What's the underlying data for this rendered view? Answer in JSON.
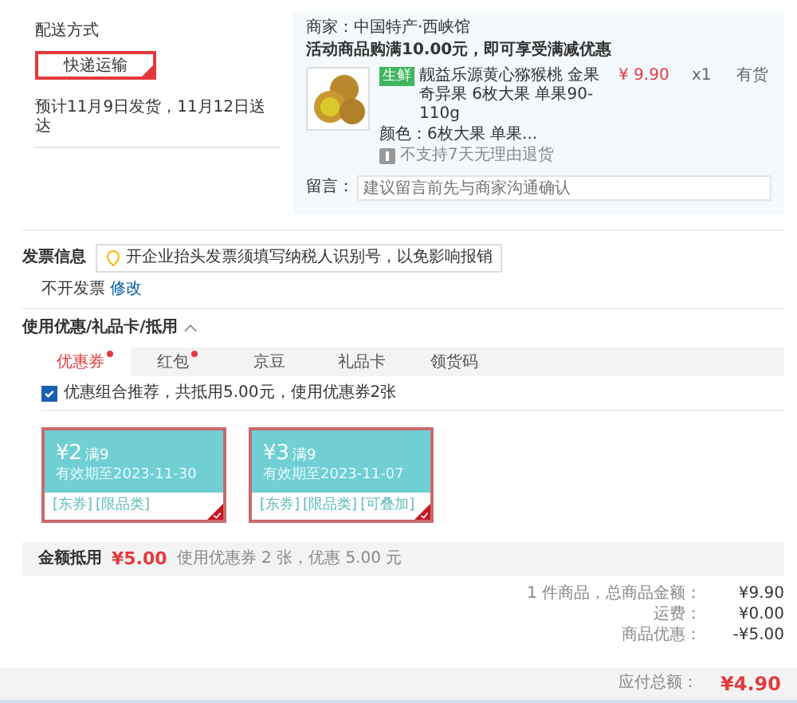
{
  "shipping": {
    "label": "配送方式",
    "method": "快递运输",
    "method_selected": true,
    "estimate": "预计11月9日发货，11月12日送达"
  },
  "shop": {
    "merchant": "商家：中国特产·西峡馆",
    "promo": "活动商品购满10.00元，即可享受满减优惠",
    "item": {
      "badge": "生鲜",
      "title": "靓益乐源黄心猕猴桃 金果奇异果 6枚大果 单果90- 110g",
      "spec": "颜色：6枚大果 单果...",
      "notice": "不支持7天无理由退货",
      "price": "¥ 9.90",
      "qty": "x1",
      "stock": "有货"
    },
    "note": {
      "label": "留言：",
      "placeholder": "建议留言前先与商家沟通确认"
    }
  },
  "invoice": {
    "title": "发票信息",
    "tip": "开企业抬头发票须填写纳税人识别号，以免影响报销",
    "value": "不开发票",
    "edit": "修改"
  },
  "discount": {
    "title": "使用优惠/礼品卡/抵用",
    "tabs": [
      {
        "label": "优惠券",
        "selected": true,
        "dot": true
      },
      {
        "label": "红包",
        "selected": false,
        "dot": true
      },
      {
        "label": "京豆",
        "selected": false,
        "dot": false
      },
      {
        "label": "礼品卡",
        "selected": false,
        "dot": false
      },
      {
        "label": "领货码",
        "selected": false,
        "dot": false
      }
    ],
    "recommend": {
      "checked": true,
      "text": "优惠组合推荐，共抵用5.00元，使用优惠券2张"
    },
    "coupons": [
      {
        "amount": "¥2",
        "condition": "满9",
        "expiry": "有效期至2023-11-30",
        "tags": [
          "[东券]",
          "[限品类]"
        ],
        "selected": true
      },
      {
        "amount": "¥3",
        "condition": "满9",
        "expiry": "有效期至2023-11-07",
        "tags": [
          "[东券]",
          "[限品类]",
          "[可叠加]"
        ],
        "selected": true
      }
    ],
    "total_label": "金额抵用",
    "total_value": "¥5.00",
    "total_desc": "使用优惠券 2 张，优惠 5.00 元"
  },
  "summary": {
    "rows": [
      {
        "label": "1 件商品，总商品金额：",
        "value": "¥9.90"
      },
      {
        "label": "运费：",
        "value": "¥0.00"
      },
      {
        "label": "商品优惠：",
        "value": "-¥5.00"
      }
    ],
    "payable_label": "应付总额：",
    "payable_value": "¥4.90"
  }
}
